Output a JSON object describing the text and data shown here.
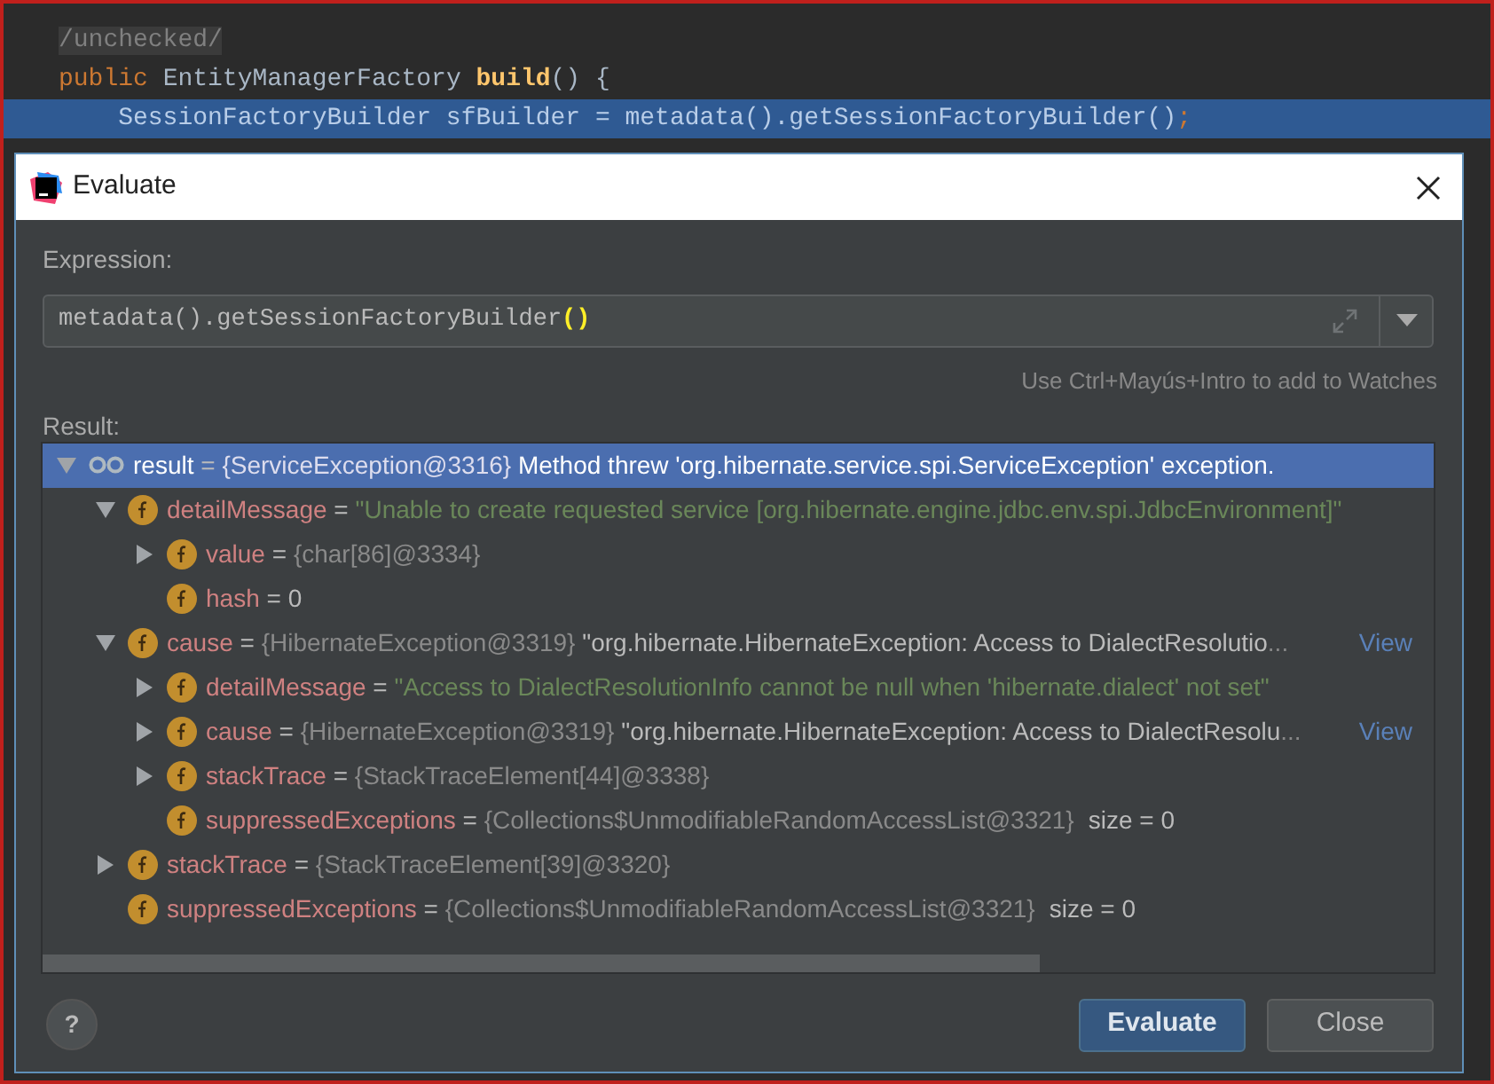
{
  "editor": {
    "lines": [
      {
        "selected": false,
        "tokens": [
          {
            "text": "/unchecked/",
            "kind": "annotation"
          }
        ]
      },
      {
        "selected": false,
        "tokens": [
          {
            "text": "public",
            "kind": "keyword"
          },
          {
            "text": " EntityManagerFactory ",
            "kind": "plain"
          },
          {
            "text": "build",
            "kind": "method"
          },
          {
            "text": "() {",
            "kind": "plain"
          }
        ]
      },
      {
        "selected": true,
        "tokens": [
          {
            "text": "    SessionFactoryBuilder sfBuilder = metadata().getSessionFactoryBuilder()",
            "kind": "plain"
          },
          {
            "text": ";",
            "kind": "keyword"
          }
        ]
      }
    ]
  },
  "dialog": {
    "title": "Evaluate",
    "expression_label": "Expression:",
    "expression": {
      "text": "metadata().getSessionFactoryBuilder",
      "matched_brackets": "()"
    },
    "hint": "Use Ctrl+Mayús+Intro to add to Watches",
    "result_label": "Result:",
    "tree": [
      {
        "kind": "watch",
        "name": "result",
        "op": "=",
        "type_ref": "{ServiceException@3316}",
        "value": "Method threw 'org.hibernate.service.spi.ServiceException' exception.",
        "is_string": false,
        "expanded": true,
        "selected": true,
        "children": [
          {
            "kind": "field",
            "name": "detailMessage",
            "op": "=",
            "value": "\"Unable to create requested service [org.hibernate.engine.jdbc.env.spi.JdbcEnvironment]\"",
            "is_string": true,
            "expanded": true,
            "selected": false,
            "children": [
              {
                "kind": "field",
                "name": "value",
                "op": "=",
                "type_ref": "{char[86]@3334}",
                "expanded": false,
                "selected": false
              },
              {
                "kind": "field",
                "name": "hash",
                "op": "=",
                "value": "0",
                "is_string": false,
                "selected": false
              }
            ]
          },
          {
            "kind": "field",
            "name": "cause",
            "op": "=",
            "type_ref": "{HibernateException@3319}",
            "value": "\"org.hibernate.HibernateException: Access to DialectResolutio",
            "is_string": false,
            "ellipsis": "...",
            "link": "View",
            "expanded": true,
            "selected": false,
            "children": [
              {
                "kind": "field",
                "name": "detailMessage",
                "op": "=",
                "value": "\"Access to DialectResolutionInfo cannot be null when 'hibernate.dialect' not set\"",
                "is_string": true,
                "expanded": false,
                "selected": false
              },
              {
                "kind": "field",
                "name": "cause",
                "op": "=",
                "type_ref": "{HibernateException@3319}",
                "value": "\"org.hibernate.HibernateException: Access to DialectResolu",
                "is_string": false,
                "ellipsis": "...",
                "link": "View",
                "expanded": false,
                "selected": false
              },
              {
                "kind": "field",
                "name": "stackTrace",
                "op": "=",
                "type_ref": "{StackTraceElement[44]@3338}",
                "expanded": false,
                "selected": false
              },
              {
                "kind": "field",
                "name": "suppressedExceptions",
                "op": "=",
                "type_ref": "{Collections$UnmodifiableRandomAccessList@3321}",
                "suffix": "size = 0",
                "selected": false
              }
            ]
          },
          {
            "kind": "field",
            "name": "stackTrace",
            "op": "=",
            "type_ref": "{StackTraceElement[39]@3320}",
            "expanded": false,
            "selected": false
          },
          {
            "kind": "field",
            "name": "suppressedExceptions",
            "op": "=",
            "type_ref": "{Collections$UnmodifiableRandomAccessList@3321}",
            "suffix": "size = 0",
            "selected": false
          }
        ]
      }
    ],
    "help": "?",
    "buttons": [
      {
        "label": "Evaluate",
        "kind": "primary"
      },
      {
        "label": "Close",
        "kind": "secondary"
      }
    ]
  }
}
